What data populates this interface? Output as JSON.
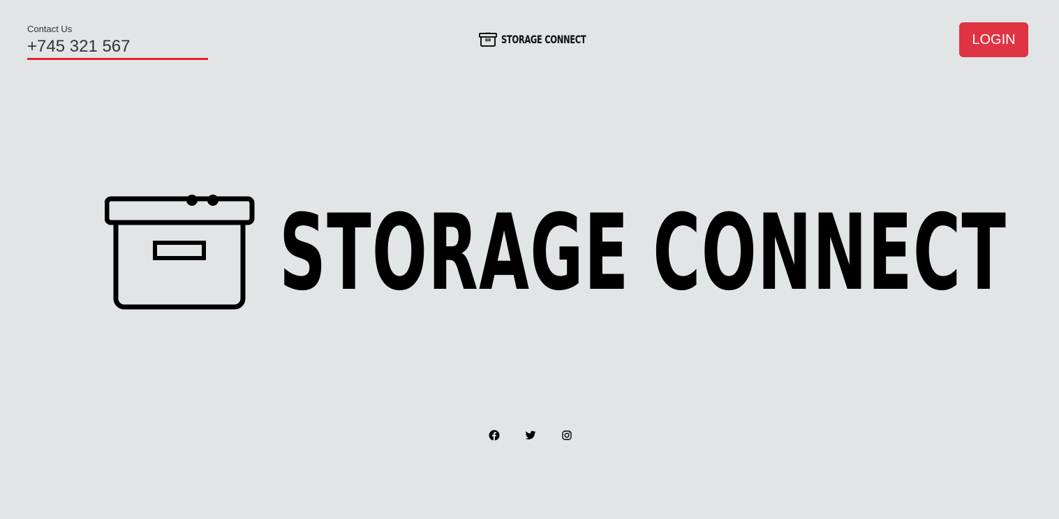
{
  "contact": {
    "label": "Contact Us",
    "phone": "+745 321 567"
  },
  "header": {
    "logo_text": "STORAGE CONNECT",
    "login_label": "LOGIN"
  },
  "hero": {
    "logo_text": "STORAGE CONNECT"
  },
  "social": [
    {
      "icon": "facebook-icon"
    },
    {
      "icon": "twitter-icon"
    },
    {
      "icon": "instagram-icon"
    }
  ],
  "colors": {
    "background": "#e1e5e6",
    "accent": "#de3444",
    "underline": "#e5202e",
    "text": "#000000"
  }
}
